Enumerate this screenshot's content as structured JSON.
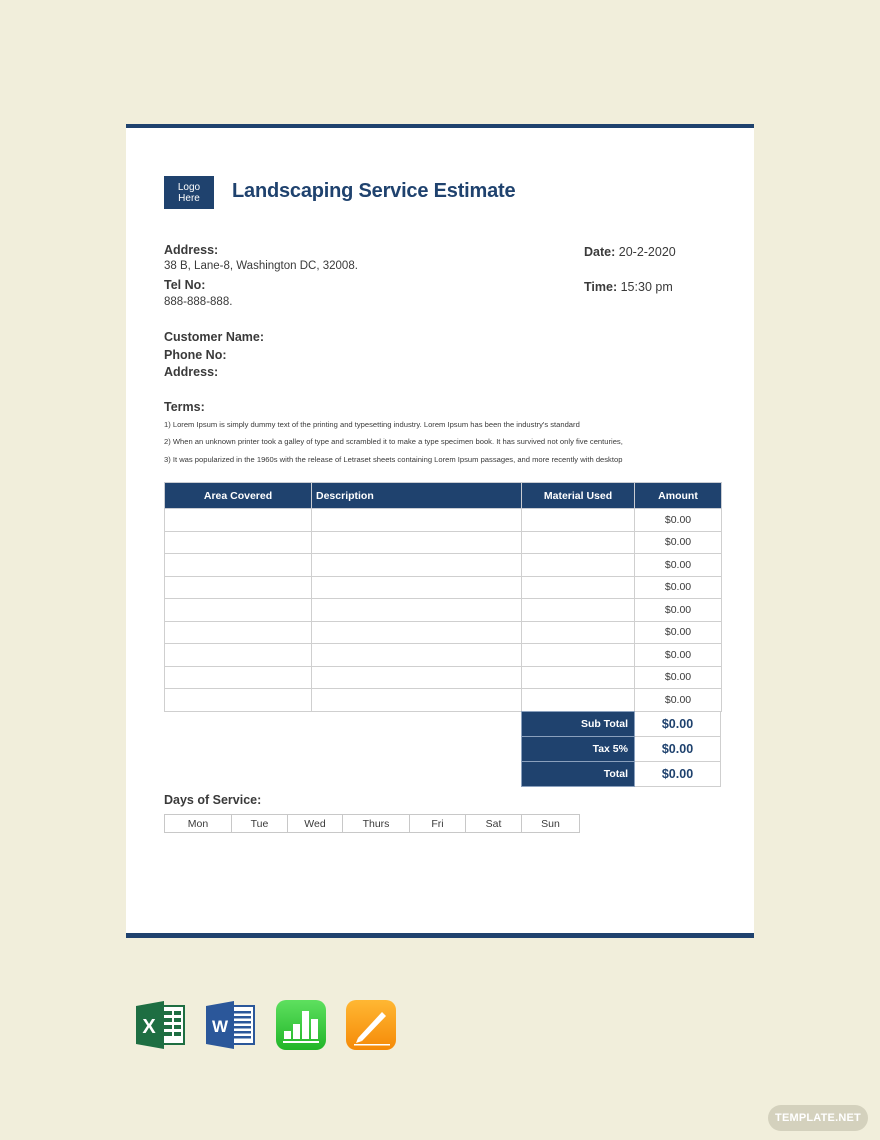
{
  "document": {
    "logo_text_line1": "Logo",
    "logo_text_line2": "Here",
    "title": "Landscaping Service Estimate",
    "company": {
      "address_label": "Address:",
      "address_value": "38 B, Lane-8, Washington DC, 32008.",
      "tel_label": "Tel No:",
      "tel_value": "888-888-888."
    },
    "date_label": "Date:",
    "date_value": "20-2-2020",
    "time_label": "Time:",
    "time_value": "15:30 pm",
    "customer": {
      "name_label": "Customer Name:",
      "phone_label": "Phone No:",
      "address_label": "Address:"
    },
    "terms": {
      "heading": "Terms:",
      "items": [
        "1) Lorem Ipsum is simply dummy text of the printing and typesetting industry. Lorem Ipsum has been the industry's standard",
        "2) When an unknown printer took a galley of type and scrambled it to make a type specimen book. It has survived not only five centuries,",
        "3) It was popularized in the 1960s with the release of Letraset sheets containing Lorem Ipsum passages, and more recently with desktop"
      ]
    },
    "table": {
      "headers": [
        "Area Covered",
        "Description",
        "Material Used",
        "Amount"
      ],
      "rows": [
        {
          "area": "",
          "description": "",
          "material": "",
          "amount": "$0.00"
        },
        {
          "area": "",
          "description": "",
          "material": "",
          "amount": "$0.00"
        },
        {
          "area": "",
          "description": "",
          "material": "",
          "amount": "$0.00"
        },
        {
          "area": "",
          "description": "",
          "material": "",
          "amount": "$0.00"
        },
        {
          "area": "",
          "description": "",
          "material": "",
          "amount": "$0.00"
        },
        {
          "area": "",
          "description": "",
          "material": "",
          "amount": "$0.00"
        },
        {
          "area": "",
          "description": "",
          "material": "",
          "amount": "$0.00"
        },
        {
          "area": "",
          "description": "",
          "material": "",
          "amount": "$0.00"
        },
        {
          "area": "",
          "description": "",
          "material": "",
          "amount": "$0.00"
        }
      ]
    },
    "totals": [
      {
        "label": "Sub Total",
        "value": "$0.00"
      },
      {
        "label": "Tax 5%",
        "value": "$0.00"
      },
      {
        "label": "Total",
        "value": "$0.00"
      }
    ],
    "days": {
      "heading": "Days of Service:",
      "items": [
        "Mon",
        "Tue",
        "Wed",
        "Thurs",
        "Fri",
        "Sat",
        "Sun"
      ]
    }
  },
  "formats": [
    {
      "name": "Excel",
      "icon": "excel-icon",
      "letter": "X",
      "color": "#1e6e42"
    },
    {
      "name": "Word",
      "icon": "word-icon",
      "letter": "W",
      "color": "#2b579a"
    },
    {
      "name": "Numbers",
      "icon": "numbers-icon",
      "color": "#34c43a"
    },
    {
      "name": "Pages",
      "icon": "pages-icon",
      "color": "#f7a11a"
    }
  ],
  "watermark": "TEMPLATE.NET",
  "colors": {
    "brand": "#1f426e",
    "background": "#f1eedb"
  }
}
